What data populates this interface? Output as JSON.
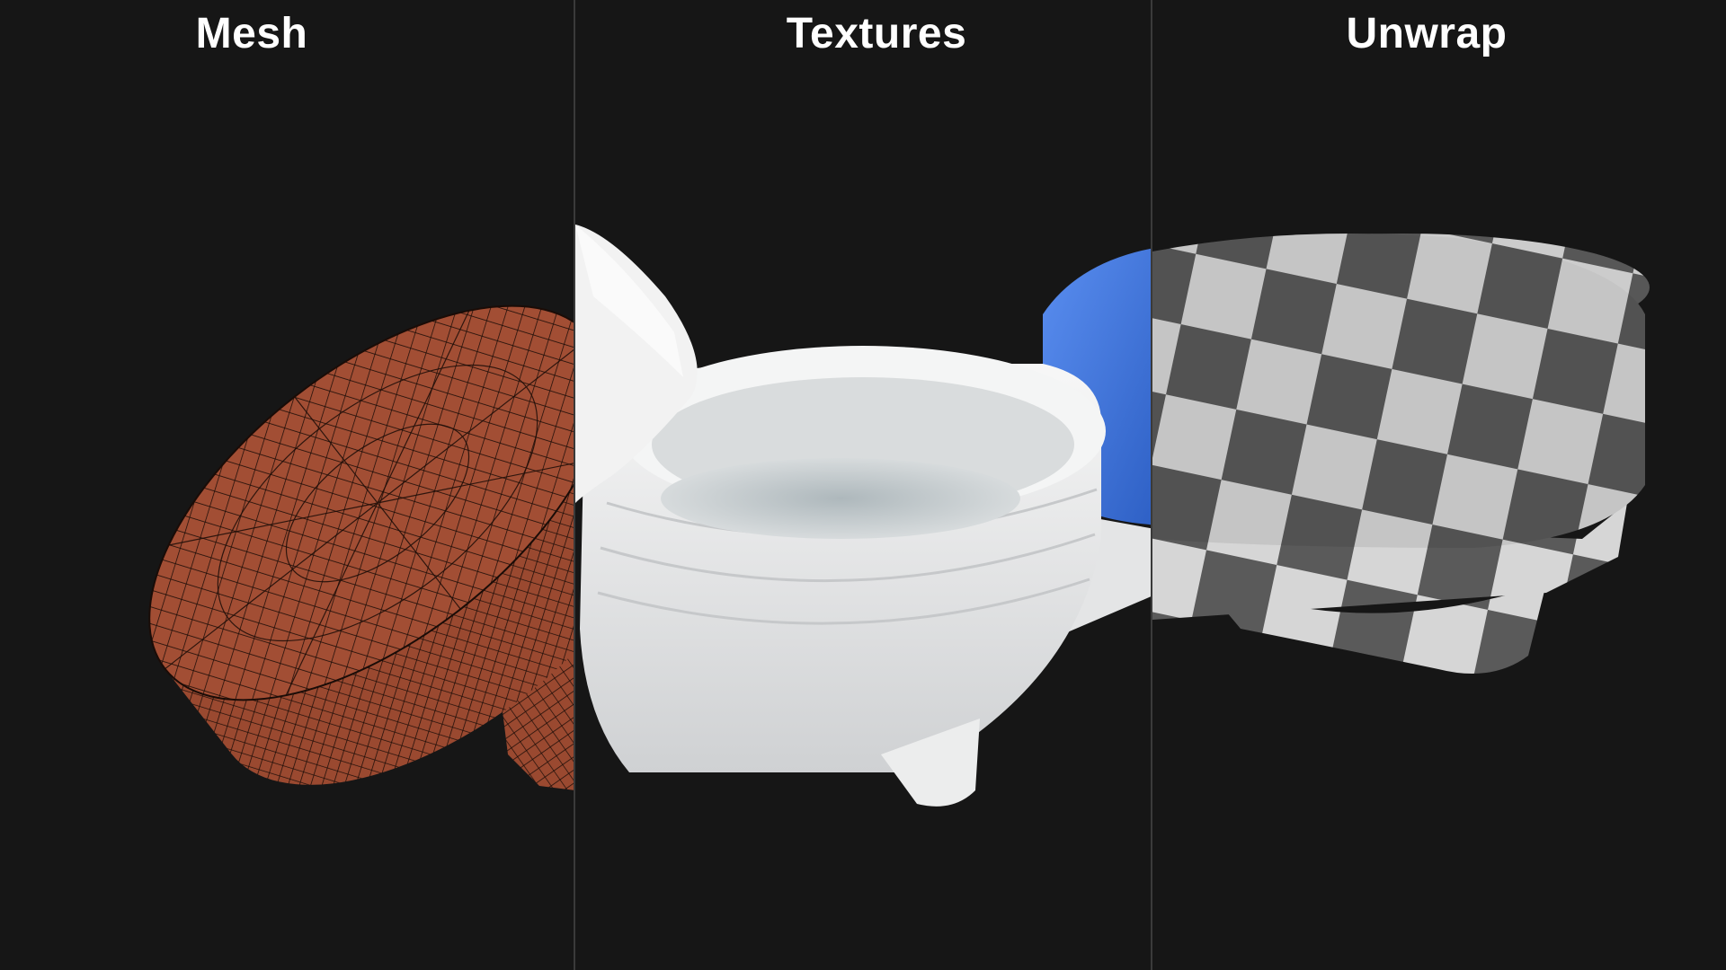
{
  "panels": [
    {
      "title": "Mesh"
    },
    {
      "title": "Textures"
    },
    {
      "title": "Unwrap"
    }
  ],
  "colors": {
    "background": "#161616",
    "divider": "#3a3a3a",
    "mesh_fill": "#a24e34",
    "mesh_wire": "#1a0c07",
    "plastic_white": "#e8e9ea",
    "cap_blue": "#3f78e0",
    "checker_light": "#d6d6d6",
    "checker_dark": "#5a5a5a",
    "title_text": "#ffffff"
  }
}
